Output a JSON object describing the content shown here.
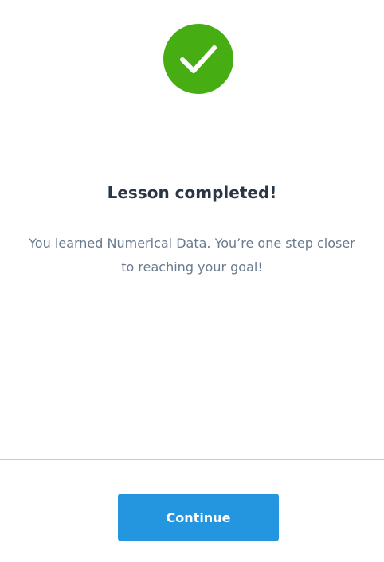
{
  "completion": {
    "icon": "checkmark-icon",
    "icon_color": "#46ae12",
    "title": "Lesson completed!",
    "message": "You learned Numerical Data. You’re one step closer to reaching your goal!"
  },
  "footer": {
    "continue_label": "Continue",
    "button_color": "#2496e0"
  }
}
